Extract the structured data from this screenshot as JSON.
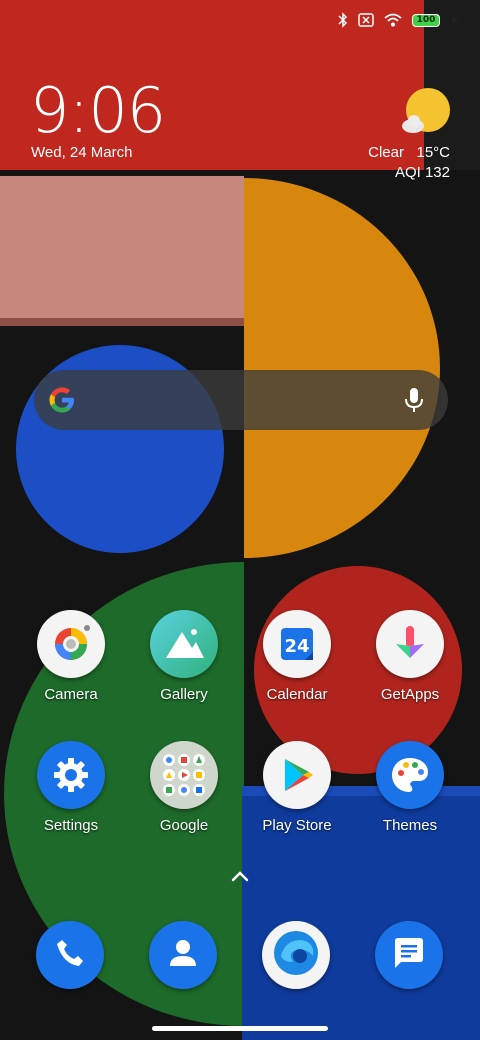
{
  "status_bar": {
    "battery_level": "100",
    "icons": [
      "bluetooth-icon",
      "sim-off-icon",
      "wifi-icon",
      "battery-icon",
      "charging-icon"
    ]
  },
  "clock": {
    "time": "9:06",
    "date": "Wed, 24 March"
  },
  "weather": {
    "icon": "partly-sunny-icon",
    "condition": "Clear",
    "temperature": "15°C",
    "aqi": "AQI 132"
  },
  "search": {
    "logo": "google-logo-icon",
    "mic": "microphone-icon"
  },
  "apps": [
    {
      "label": "Camera",
      "icon": "camera-icon"
    },
    {
      "label": "Gallery",
      "icon": "gallery-icon"
    },
    {
      "label": "Calendar",
      "icon": "calendar-icon",
      "day": "24"
    },
    {
      "label": "GetApps",
      "icon": "getapps-icon"
    },
    {
      "label": "Settings",
      "icon": "settings-icon"
    },
    {
      "label": "Google",
      "icon": "google-folder-icon"
    },
    {
      "label": "Play Store",
      "icon": "play-store-icon"
    },
    {
      "label": "Themes",
      "icon": "themes-icon"
    }
  ],
  "dock": [
    {
      "icon": "phone-icon"
    },
    {
      "icon": "contacts-icon"
    },
    {
      "icon": "browser-icon"
    },
    {
      "icon": "messages-icon"
    }
  ],
  "colors": {
    "red": "#c0281f",
    "pink": "#c7877c",
    "orange": "#d7870d",
    "blue": "#1c4fc5",
    "green": "#1d6a2a",
    "dark_red": "#b0241d",
    "dark_blue": "#0f3b9c",
    "icon_blue": "#1a73e8"
  }
}
